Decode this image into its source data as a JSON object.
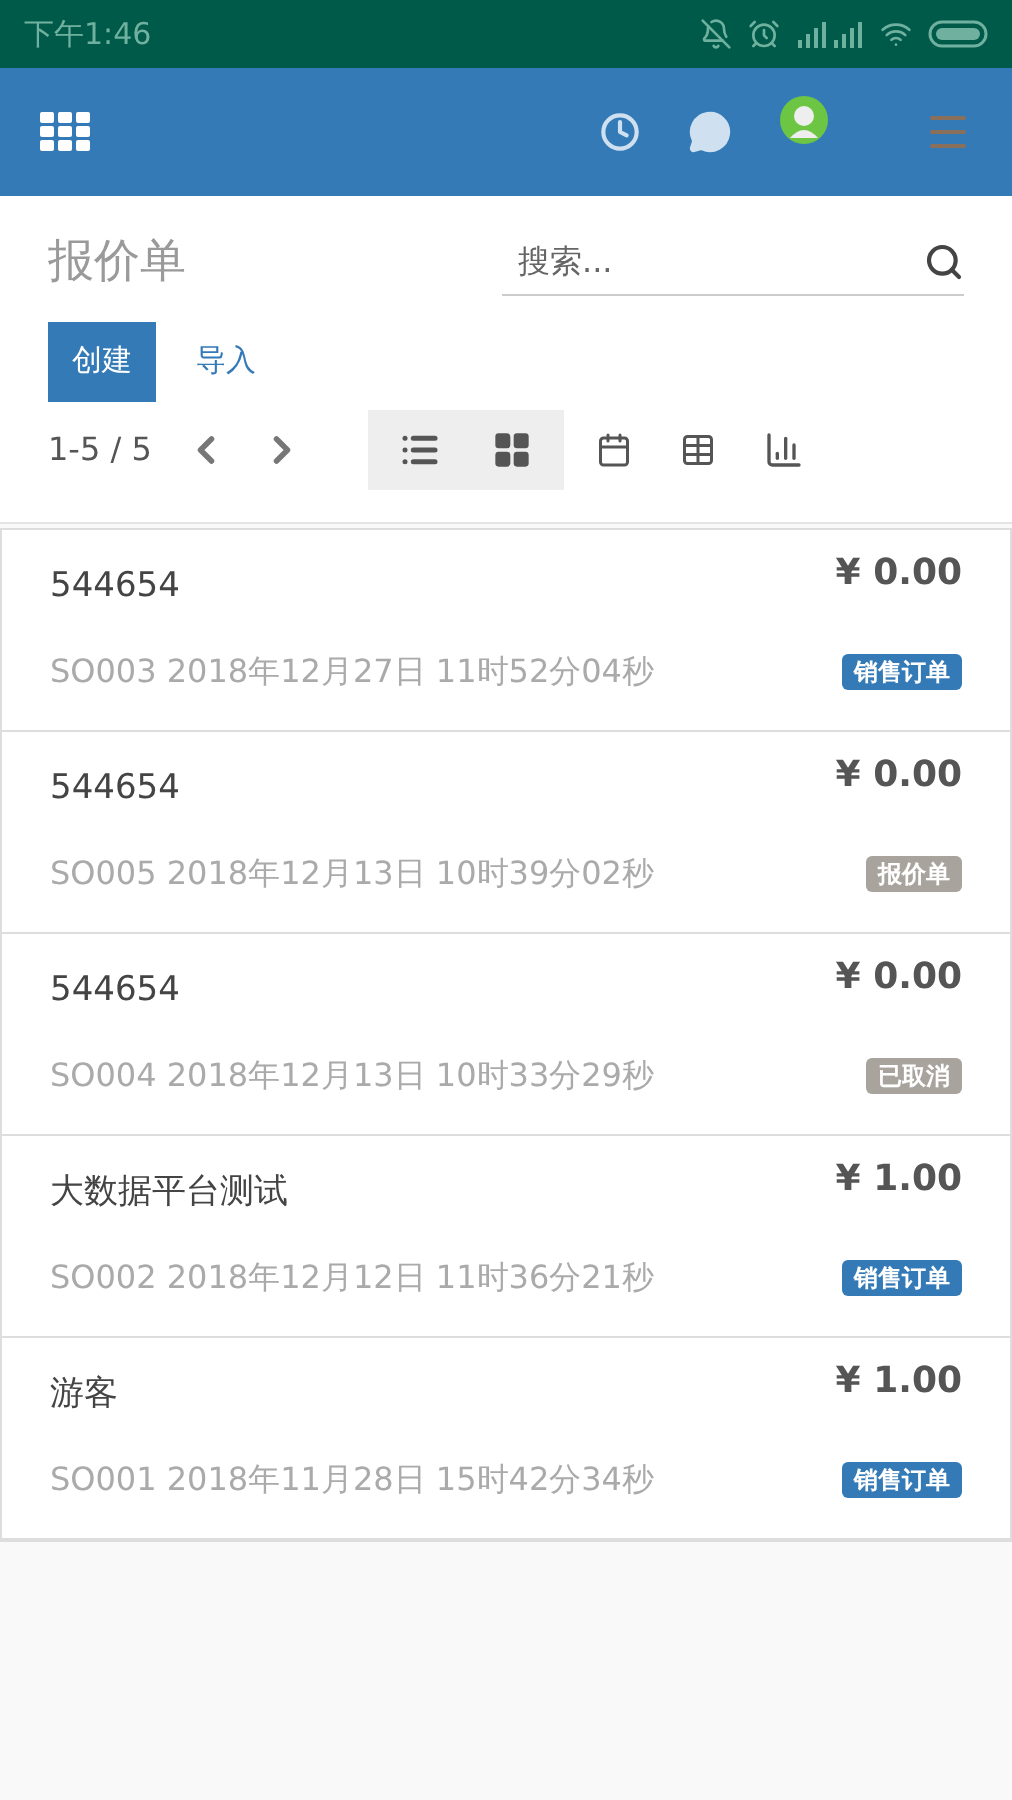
{
  "status_bar": {
    "time": "下午1:46"
  },
  "page": {
    "title": "报价单",
    "search": {
      "placeholder": "搜索..."
    },
    "buttons": [
      {
        "label": "创建",
        "kind": "primary"
      },
      {
        "label": "导入",
        "kind": "link"
      }
    ],
    "pager": "1-5 / 5"
  },
  "records": [
    {
      "name": "544654",
      "amount": "¥ 0.00",
      "reference": "SO003 2018年12月27日 11时52分04秒",
      "status": "销售订单",
      "color": "#337ab7"
    },
    {
      "name": "544654",
      "amount": "¥ 0.00",
      "reference": "SO005 2018年12月13日 10时39分02秒",
      "status": "报价单",
      "color": "#a8a39d"
    },
    {
      "name": "544654",
      "amount": "¥ 0.00",
      "reference": "SO004 2018年12月13日 10时33分29秒",
      "status": "已取消",
      "color": "#a8a39d"
    },
    {
      "name": "大数据平台测试",
      "amount": "¥ 1.00",
      "reference": "SO002 2018年12月12日 11时36分21秒",
      "status": "销售订单",
      "color": "#337ab7"
    },
    {
      "name": "游客",
      "amount": "¥ 1.00",
      "reference": "SO001 2018年11月28日 15时42分34秒",
      "status": "销售订单",
      "color": "#337ab7"
    }
  ]
}
